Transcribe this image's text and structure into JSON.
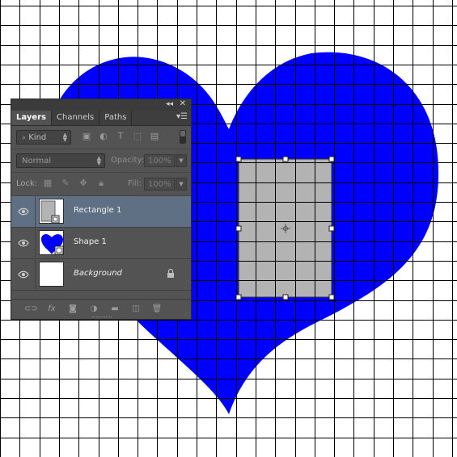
{
  "canvas": {
    "grid_color": "#000000",
    "background_color": "#ffffff",
    "heart_color": "#0000ff",
    "rectangle_fill": "#b3b3b3"
  },
  "panel": {
    "collapse_icon": "double-chevron-right-icon",
    "close_icon": "close-icon",
    "menu_icon": "panel-menu-icon",
    "tabs": [
      {
        "label": "Layers",
        "active": true
      },
      {
        "label": "Channels",
        "active": false
      },
      {
        "label": "Paths",
        "active": false
      }
    ],
    "filter": {
      "kind_label": "Kind",
      "icons": [
        "pixel-filter-icon",
        "adjustment-filter-icon",
        "type-filter-icon",
        "shape-filter-icon",
        "smart-object-filter-icon"
      ]
    },
    "blend": {
      "mode": "Normal",
      "opacity_label": "Opacity:",
      "opacity_value": "100%"
    },
    "lock": {
      "label": "Lock:",
      "fill_label": "Fill:",
      "fill_value": "100%"
    },
    "layers": [
      {
        "name": "Rectangle 1",
        "selected": true,
        "visible": true,
        "thumb": "rectangle"
      },
      {
        "name": "Shape 1",
        "selected": false,
        "visible": true,
        "thumb": "heart"
      },
      {
        "name": "Background",
        "selected": false,
        "visible": true,
        "thumb": "white",
        "locked": true
      }
    ],
    "footer_icons": [
      "link-layers-icon",
      "fx-icon",
      "mask-icon",
      "adjustment-layer-icon",
      "group-folder-icon",
      "new-layer-icon",
      "trash-icon"
    ],
    "fx_text": "fx"
  }
}
